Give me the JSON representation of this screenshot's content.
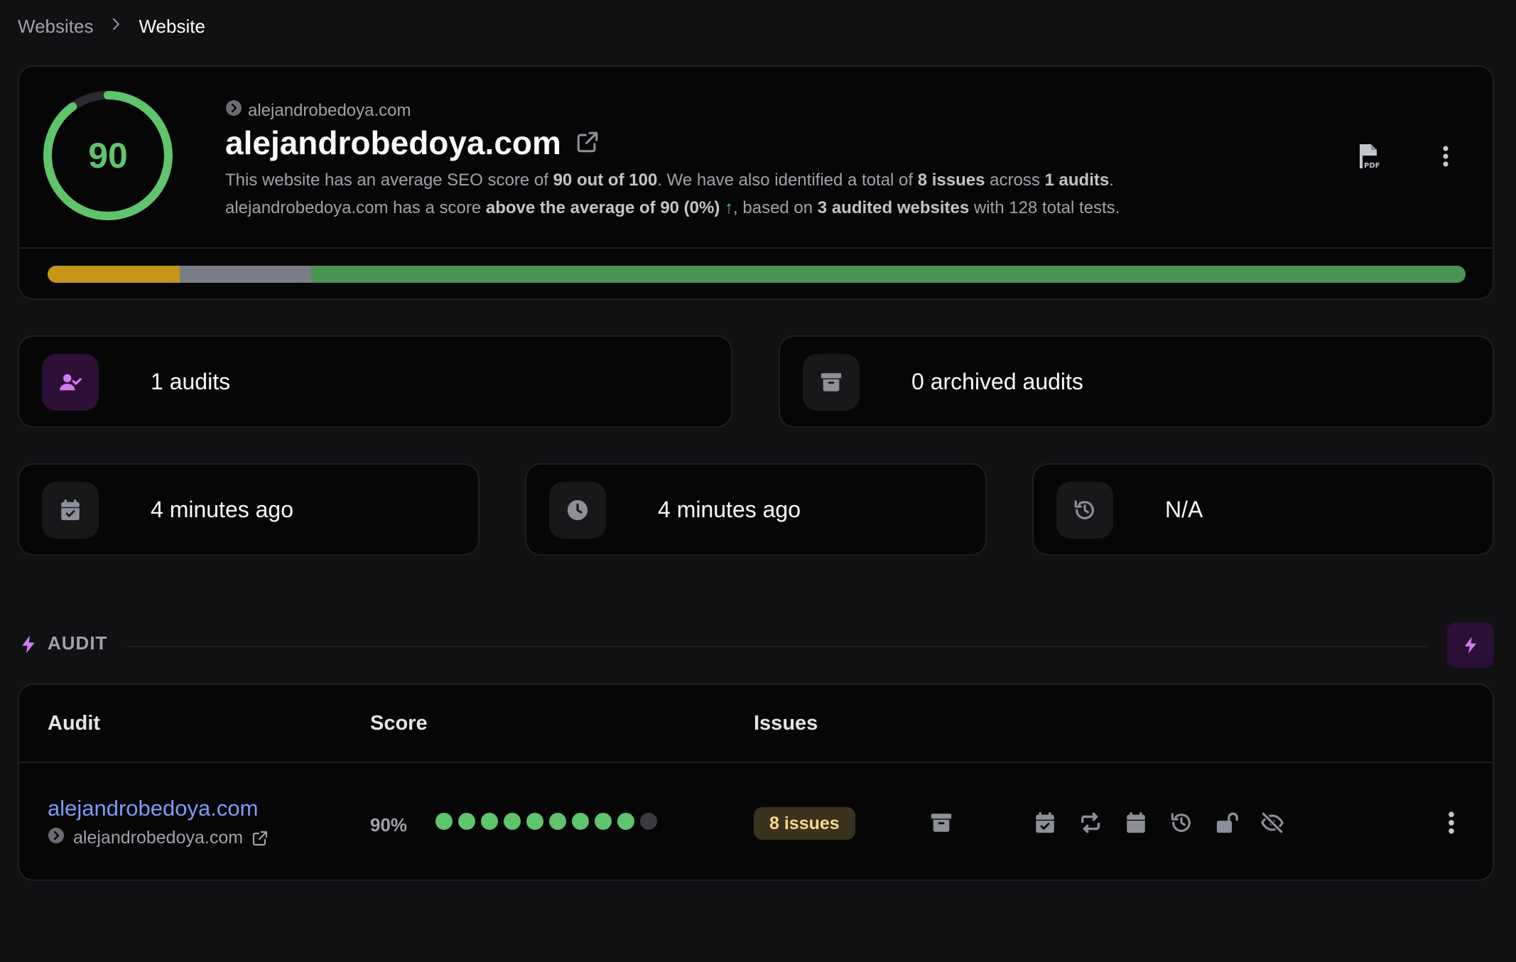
{
  "breadcrumb": {
    "parent": "Websites",
    "current": "Website"
  },
  "header": {
    "score": "90",
    "score_fraction": 0.9,
    "subdomain": "alejandrobedoya.com",
    "title": "alejandrobedoya.com",
    "desc1_pre": "This website has an average SEO score of ",
    "desc1_score": "90 out of 100",
    "desc1_mid": ". We have also identified a total of ",
    "desc1_issues": "8 issues",
    "desc1_mid2": " across ",
    "desc1_audits": "1 audits",
    "desc1_end": ".",
    "desc2_pre": "alejandrobedoya.com has a score ",
    "desc2_avg": "above the average of 90 (0%)",
    "desc2_arrow": "↑",
    "desc2_mid": ", based on ",
    "desc2_sites": "3 audited websites",
    "desc2_end": " with 128 total tests.",
    "progress": [
      {
        "fraction": 0.093,
        "color": "#c59518"
      },
      {
        "fraction": 0.093,
        "color": "#7a7c86"
      },
      {
        "fraction": 0.814,
        "color": "#4a9553"
      }
    ]
  },
  "stats": {
    "audits": "1 audits",
    "archived": "0 archived audits",
    "created": "4 minutes ago",
    "updated": "4 minutes ago",
    "history": "N/A"
  },
  "audit_section": {
    "label": "AUDIT"
  },
  "table": {
    "headers": {
      "audit": "Audit",
      "score": "Score",
      "issues": "Issues"
    },
    "row": {
      "title": "alejandrobedoya.com",
      "subdomain": "alejandrobedoya.com",
      "score": "90%",
      "score_dots_filled": 9,
      "score_dots_total": 10,
      "issues": "8 issues"
    }
  },
  "colors": {
    "accent_green": "#5fc46b",
    "accent_purple": "#d57cf5",
    "link_blue": "#7c9cf5",
    "icon_gray": "#8d8f99"
  }
}
